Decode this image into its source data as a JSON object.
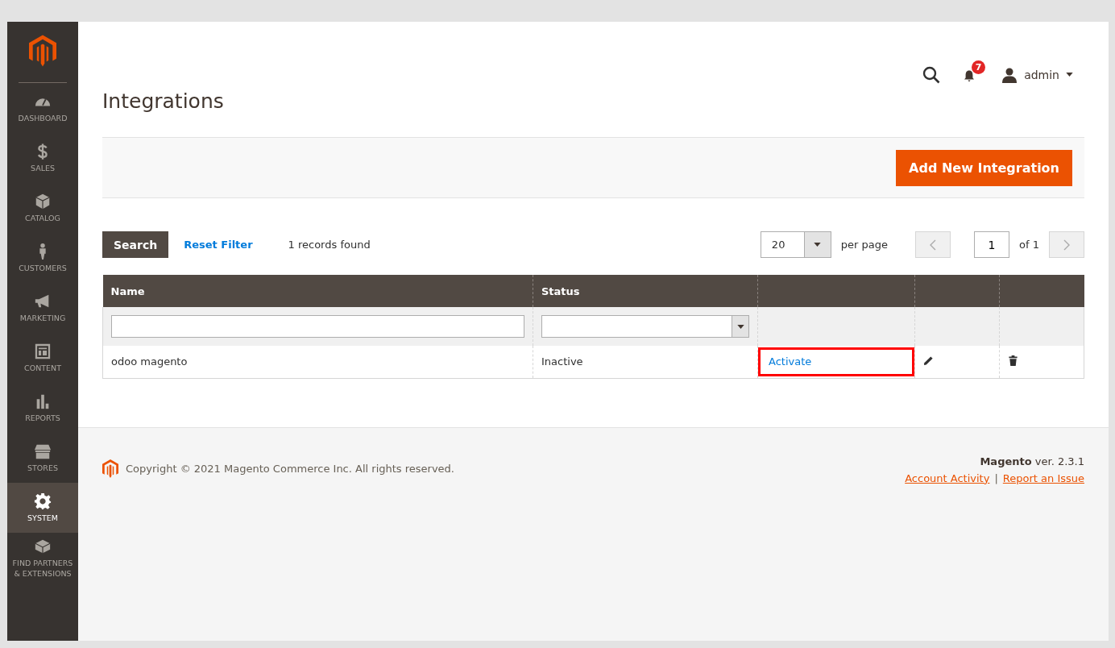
{
  "sidebar": {
    "items": [
      {
        "label": "DASHBOARD",
        "kind": "dashboard",
        "selected": false
      },
      {
        "label": "SALES",
        "kind": "sales",
        "selected": false
      },
      {
        "label": "CATALOG",
        "kind": "catalog",
        "selected": false
      },
      {
        "label": "CUSTOMERS",
        "kind": "customers",
        "selected": false
      },
      {
        "label": "MARKETING",
        "kind": "marketing",
        "selected": false
      },
      {
        "label": "CONTENT",
        "kind": "content",
        "selected": false
      },
      {
        "label": "REPORTS",
        "kind": "reports",
        "selected": false
      },
      {
        "label": "STORES",
        "kind": "stores",
        "selected": false
      },
      {
        "label": "SYSTEM",
        "kind": "system",
        "selected": true
      },
      {
        "label": "FIND PARTNERS & EXTENSIONS",
        "kind": "partners",
        "selected": false
      }
    ]
  },
  "header": {
    "title": "Integrations",
    "notifications": "7",
    "user": "admin"
  },
  "actions": {
    "add_button": "Add New Integration"
  },
  "toolbar": {
    "search_button": "Search",
    "reset_link": "Reset Filter",
    "records": "1 records found",
    "per_page_value": "20",
    "per_page_label": "per page",
    "page_value": "1",
    "page_total": "of 1"
  },
  "table": {
    "columns": [
      {
        "label": "Name"
      },
      {
        "label": "Status"
      }
    ],
    "rows": [
      {
        "name": "odoo magento",
        "status": "Inactive",
        "action": "Activate",
        "highlighted": true
      }
    ]
  },
  "footer": {
    "copyright": "Copyright © 2021 Magento Commerce Inc. All rights reserved.",
    "version": "**Magento** ver. 2.3.1",
    "links": [
      "Account Activity",
      "Report an Issue"
    ],
    "separator": "|"
  }
}
